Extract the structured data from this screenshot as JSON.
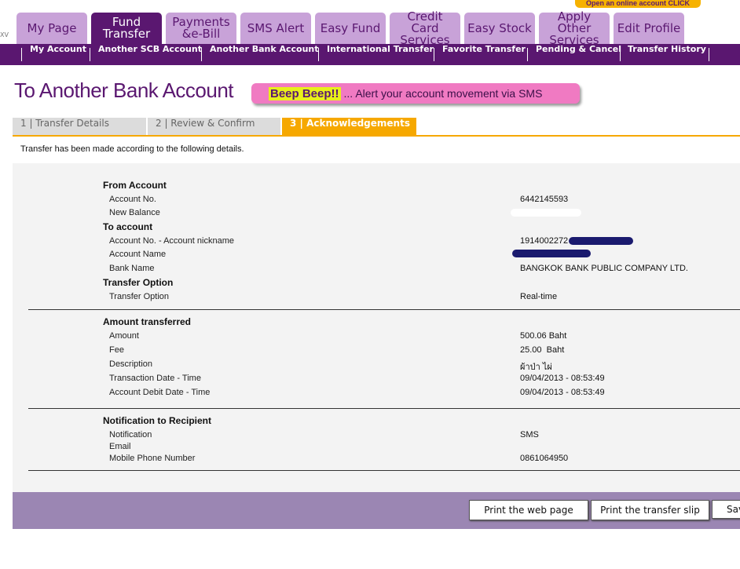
{
  "promo": {
    "text": "Open an online account CLICK"
  },
  "corner_text": "XV",
  "tabs": [
    {
      "label": "My Page"
    },
    {
      "label": "Fund Transfer"
    },
    {
      "label": "Payments &e-Bill"
    },
    {
      "label": "SMS Alert"
    },
    {
      "label": "Easy Fund"
    },
    {
      "label": "Credit Card Services"
    },
    {
      "label": "Easy Stock"
    },
    {
      "label": "Apply Other Services"
    },
    {
      "label": "Edit Profile"
    }
  ],
  "subnav": [
    {
      "label": "My Account"
    },
    {
      "label": "Another SCB Account"
    },
    {
      "label": "Another Bank Account"
    },
    {
      "label": "International Transfer"
    },
    {
      "label": "Favorite Transfer"
    },
    {
      "label": "Pending & Cancel"
    },
    {
      "label": "Transfer History"
    }
  ],
  "page_title": "To Another Bank Account",
  "banner": {
    "strong": "Beep Beep!!",
    "text": "... Alert your account movement via SMS"
  },
  "steps": [
    {
      "label": "1 | Transfer Details"
    },
    {
      "label": "2 | Review & Confirm"
    },
    {
      "label": "3 | Acknowledgements"
    }
  ],
  "intro": "Transfer has been made according to the following details.",
  "sections": {
    "from_account": {
      "title": "From Account",
      "account_no_label": "Account No.",
      "account_no": "6442145593",
      "new_balance_label": "New Balance"
    },
    "to_account": {
      "title": "To account",
      "account_nick_label": "Account No. - Account nickname",
      "account_no": "1914002272",
      "account_name_label": "Account Name",
      "bank_name_label": "Bank Name",
      "bank_name": "BANGKOK BANK PUBLIC COMPANY LTD."
    },
    "transfer_option": {
      "title": "Transfer Option",
      "label": "Transfer Option",
      "value": "Real-time"
    },
    "amount": {
      "title": "Amount transferred",
      "amount_label": "Amount",
      "amount": "500.06 Baht",
      "fee_label": "Fee",
      "fee": "25.00  Baht",
      "description_label": "Description",
      "description": "ผ้าป่า ไผ่",
      "transaction_label": "Transaction Date - Time",
      "transaction": "09/04/2013 - 08:53:49",
      "debit_label": "Account Debit Date - Time",
      "debit": "09/04/2013 - 08:53:49"
    },
    "notification": {
      "title": "Notification to Recipient",
      "notification_label": "Notification",
      "notification": "SMS",
      "email_label": "Email",
      "mobile_label": "Mobile Phone Number",
      "mobile": "0861064950"
    }
  },
  "buttons": {
    "print_page": "Print the web page",
    "print_slip": "Print the transfer slip",
    "save": "Save"
  }
}
